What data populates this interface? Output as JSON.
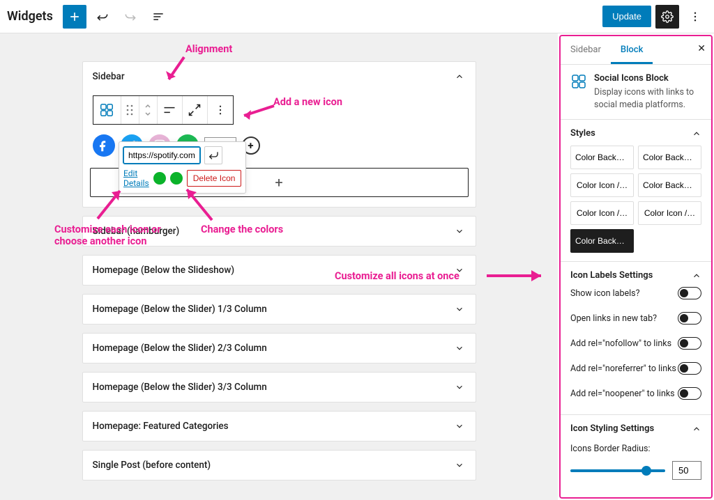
{
  "header": {
    "page_title": "Widgets",
    "update_label": "Update"
  },
  "annotations": {
    "alignment": "Alignment",
    "add_icon": "Add a new icon",
    "customize_icon": "Customize each icon or\nchoose another icon",
    "change_colors": "Change the colors",
    "customize_all": "Customize all icons at once"
  },
  "widget_areas": {
    "sidebar_label": "Sidebar",
    "sidebar_hamburger": "Sidebar (hamburger)",
    "homepage_slideshow": "Homepage (Below the Slideshow)",
    "homepage_slider_13": "Homepage (Below the Slider) 1/3 Column",
    "homepage_slider_23": "Homepage (Below the Slider) 2/3 Column",
    "homepage_slider_33": "Homepage (Below the Slider) 3/3 Column",
    "featured_categories": "Homepage: Featured Categories",
    "single_post": "Single Post (before content)"
  },
  "url_popover": {
    "value": "https://spotify.com",
    "edit_label": "Edit",
    "details_label": "Details",
    "delete_label": "Delete Icon"
  },
  "sidebar_panel": {
    "tab1": "Sidebar",
    "tab2": "Block",
    "block_title": "Social Icons Block",
    "block_desc": "Display icons with links to social media platforms.",
    "styles_heading": "Styles",
    "styles": {
      "a": "Color Backgr…",
      "b": "Color Backgr…",
      "c": "Color Icon /…",
      "d": "Color Backgr…",
      "e": "Color Icon /…",
      "f": "Color Icon /…",
      "g": "Color Backgr…"
    },
    "labels_heading": "Icon Labels Settings",
    "toggles": {
      "show_labels": "Show icon labels?",
      "new_tab": "Open links in new tab?",
      "nofollow": "Add rel=\"nofollow\" to links",
      "noreferrer": "Add rel=\"noreferrer\" to links",
      "noopener": "Add rel=\"noopener\" to links"
    },
    "styling_heading": "Icon Styling Settings",
    "radius_label": "Icons Border Radius:",
    "radius_value": "50"
  }
}
